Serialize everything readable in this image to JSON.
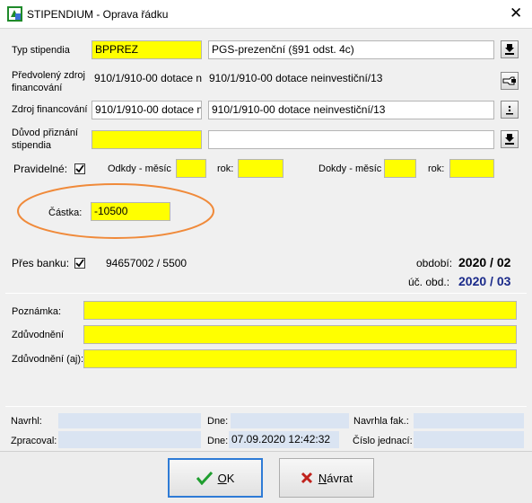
{
  "window": {
    "title": "STIPENDIUM - Oprava řádku",
    "close_glyph": "✕",
    "icon": "app-icon"
  },
  "typ": {
    "label": "Typ stipendia",
    "code": "BPPREZ",
    "text": "PGS-prezenční (§91 odst. 4c)"
  },
  "predvoleny": {
    "label_line1": "Předvolený zdroj",
    "label_line2": "financování",
    "code": "910/1/910-00 dotace n",
    "text": "910/1/910-00 dotace neinvestiční/13"
  },
  "zdroj": {
    "label": "Zdroj financování",
    "code": "910/1/910-00 dotace n",
    "text": "910/1/910-00 dotace neinvestiční/13"
  },
  "duvod": {
    "label_line1": "Důvod přiznání",
    "label_line2": "stipendia",
    "code": "",
    "text": ""
  },
  "pravidelne": {
    "label": "Pravidelné:",
    "checked": true,
    "odkdy_mesic_label": "Odkdy - měsíc",
    "odkdy_mesic": "",
    "odkdy_rok_label": "rok:",
    "odkdy_rok": "",
    "dokdy_mesic_label": "Dokdy - měsíc",
    "dokdy_mesic": "",
    "dokdy_rok_label": "rok:",
    "dokdy_rok": ""
  },
  "castka": {
    "label": "Částka:",
    "value": "-10500"
  },
  "banka": {
    "label": "Přes banku:",
    "checked": true,
    "account": "94657002 / 5500"
  },
  "obdobi": {
    "label": "období:",
    "value": "2020 / 02",
    "uc_label": "úč. obd.:",
    "uc_value": "2020 / 03"
  },
  "poznamka": {
    "label": "Poznámka:",
    "value": ""
  },
  "zduvodneni": {
    "label": "Zdůvodnění",
    "value": ""
  },
  "zduvodneni_aj": {
    "label": "Zdůvodnění (aj):",
    "value": ""
  },
  "footer": {
    "navrhl_label": "Navrhl:",
    "navrhl": "",
    "dne_label": "Dne:",
    "dne1": "",
    "navrhla_fak_label": "Navrhla fak.:",
    "navrhla_fak": "",
    "zpracoval_label": "Zpracoval:",
    "zpracoval": "",
    "dne2_label": "Dne:",
    "dne2": "07.09.2020 12:42:32",
    "cislo_label": "Číslo jednací:",
    "cislo": ""
  },
  "buttons": {
    "ok_prefix": "",
    "ok_ul": "O",
    "ok_rest": "K",
    "navrat_prefix": "",
    "navrat_ul": "N",
    "navrat_rest": "ávrat"
  },
  "colors": {
    "required": "#ffff00",
    "readonly": "#dae4f2",
    "highlight_ellipse": "#f08a3a",
    "ok_check": "#1f9e2f",
    "cancel_x": "#c0221c"
  }
}
